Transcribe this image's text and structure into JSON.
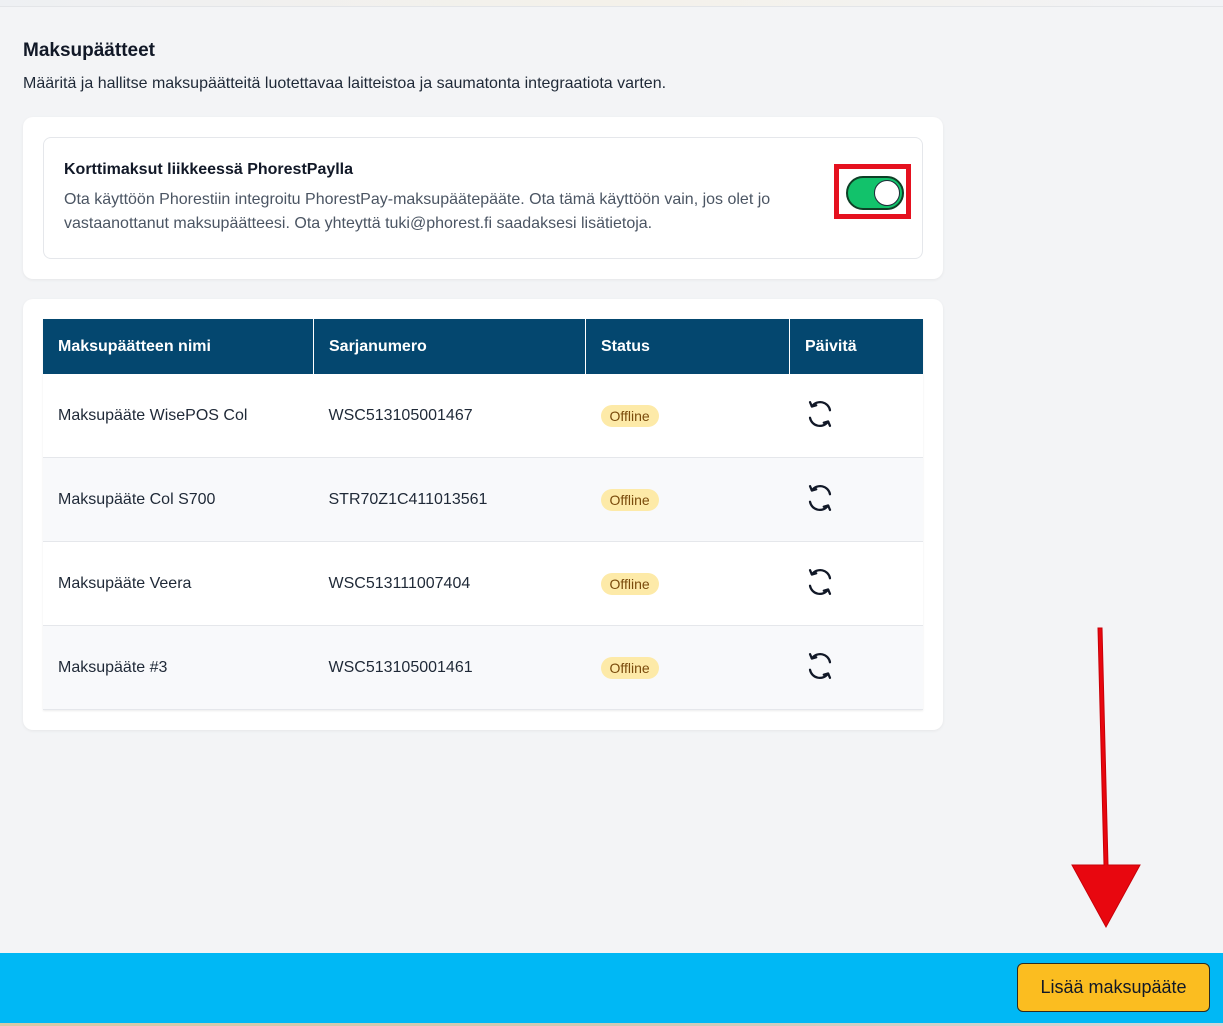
{
  "page": {
    "title": "Maksupäätteet",
    "subtitle": "Määritä ja hallitse maksupäätteitä luotettavaa laitteistoa ja saumatonta integraatiota varten."
  },
  "toggle_card": {
    "title": "Korttimaksut liikkeessä PhorestPaylla",
    "description": "Ota käyttöön Phorestiin integroitu PhorestPay-maksupäätepääte. Ota tämä käyttöön vain, jos olet jo vastaanottanut maksupäätteesi. Ota yhteyttä tuki@phorest.fi saadaksesi lisätietoja.",
    "enabled": true,
    "toggle_color": "#12c26b",
    "highlight_color": "#e5111f"
  },
  "table": {
    "headers": [
      "Maksupäätteen nimi",
      "Sarjanumero",
      "Status",
      "Päivitä"
    ],
    "rows": [
      {
        "name": "Maksupääte WisePOS Col",
        "serial": "WSC513105001467",
        "status": "Offline",
        "action_icon": "refresh-icon"
      },
      {
        "name": "Maksupääte Col S700",
        "serial": "STR70Z1C411013561",
        "status": "Offline",
        "action_icon": "refresh-icon"
      },
      {
        "name": "Maksupääte Veera",
        "serial": "WSC513111007404",
        "status": "Offline",
        "action_icon": "refresh-icon"
      },
      {
        "name": "Maksupääte #3",
        "serial": "WSC513105001461",
        "status": "Offline",
        "action_icon": "refresh-icon"
      }
    ],
    "header_color": "#04476f",
    "status_badge_color": "#fdeaa8"
  },
  "footer": {
    "add_button_label": "Lisää maksupääte",
    "bar_color": "#00b8f5",
    "button_color": "#fbbd20"
  },
  "annotation": {
    "arrow_color": "#e8070f",
    "arrow_icon": "arrow-down-icon"
  }
}
